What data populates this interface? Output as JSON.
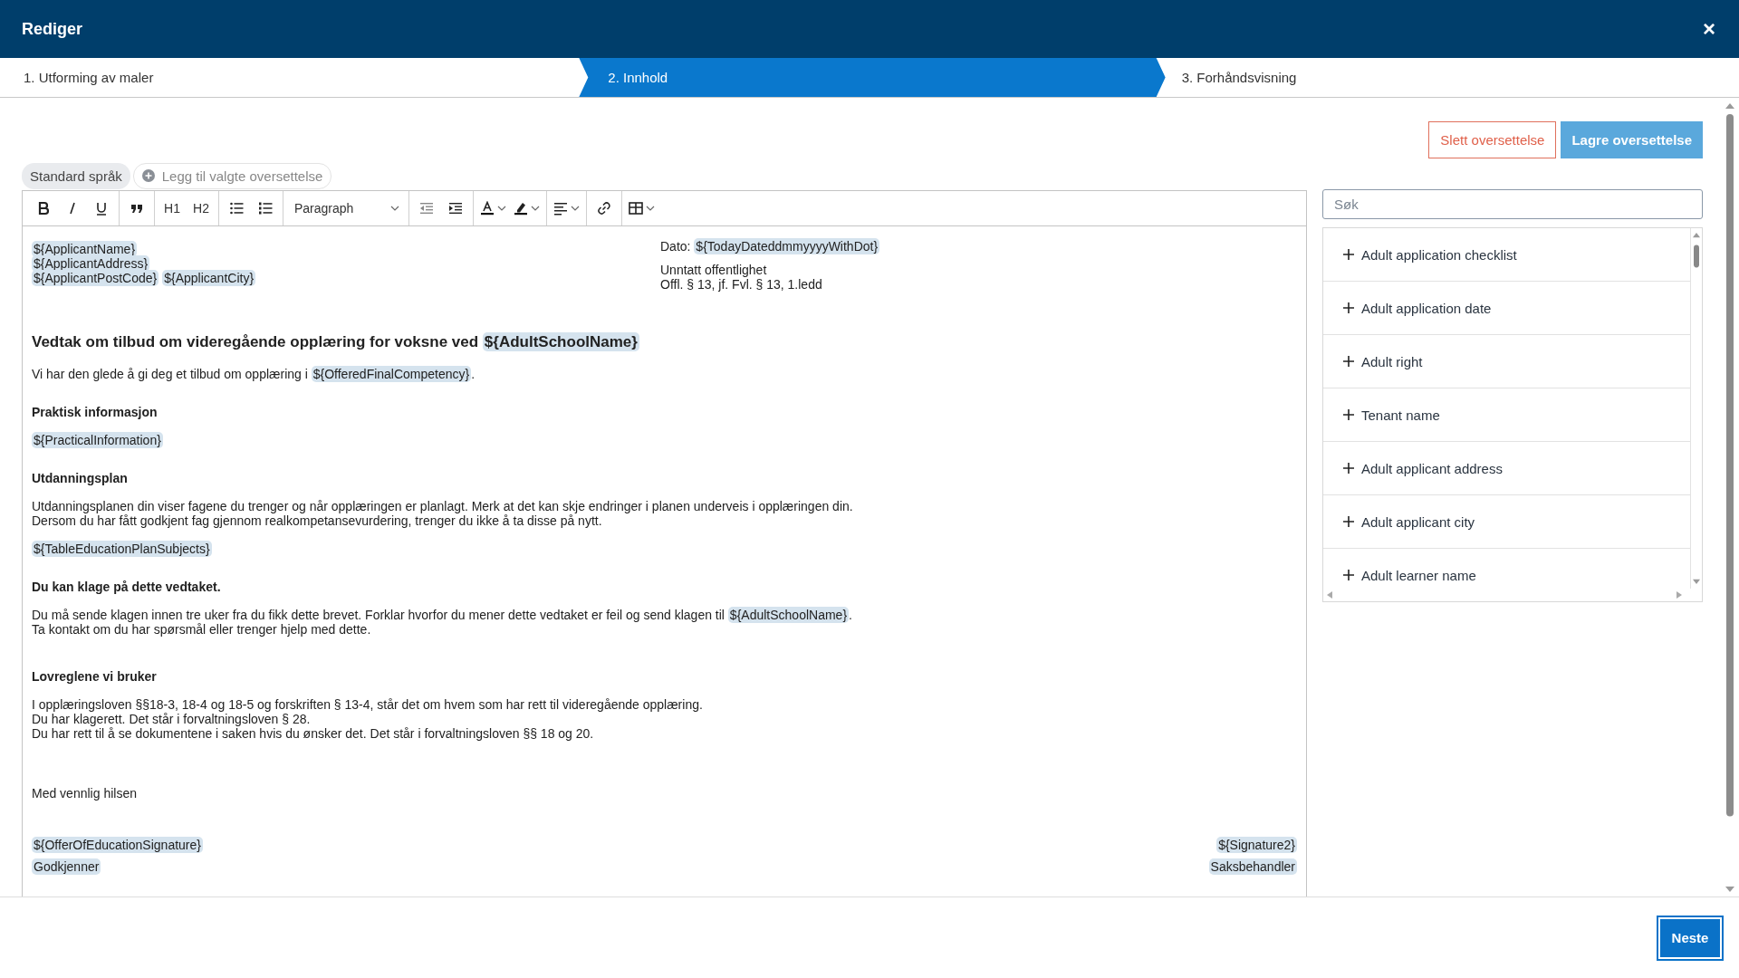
{
  "window": {
    "title": "Rediger",
    "close": "×"
  },
  "steps": [
    {
      "label": "1. Utforming av maler",
      "selected": false
    },
    {
      "label": "2. Innhold",
      "selected": true
    },
    {
      "label": "3. Forhåndsvisning",
      "selected": false
    }
  ],
  "actions": {
    "delete": "Slett oversettelse",
    "save": "Lagre oversettelse"
  },
  "languages": [
    {
      "label": "Standard språk",
      "kind": "chip"
    },
    {
      "label": "Legg til valgte oversettelse",
      "kind": "add"
    }
  ],
  "toolbar": [
    [
      {
        "kind": "bold"
      },
      {
        "kind": "italic"
      },
      {
        "kind": "underline"
      }
    ],
    [
      {
        "kind": "quote"
      }
    ],
    [
      {
        "kind": "heading",
        "label": "H1"
      },
      {
        "kind": "heading",
        "label": "H2"
      }
    ],
    [
      {
        "kind": "bullets"
      },
      {
        "kind": "numbers"
      }
    ],
    [
      {
        "kind": "format",
        "label": "Paragraph"
      }
    ],
    [
      {
        "kind": "outdent"
      },
      {
        "kind": "indent"
      }
    ],
    [
      {
        "kind": "font-color"
      },
      {
        "kind": "highlight"
      }
    ],
    [
      {
        "kind": "align"
      }
    ],
    [
      {
        "kind": "link"
      }
    ],
    [
      {
        "kind": "table"
      }
    ]
  ],
  "document": {
    "address": [
      [
        {
          "kind": "tag",
          "text": "${ApplicantName}"
        }
      ],
      [
        {
          "kind": "tag",
          "text": "${ApplicantAddress}"
        }
      ],
      [
        {
          "kind": "tag",
          "text": "${ApplicantPostCode}"
        },
        {
          "kind": "tag",
          "text": "${ApplicantCity}"
        }
      ]
    ],
    "meta": [
      [
        {
          "kind": "text",
          "text": "Dato: "
        },
        {
          "kind": "tag",
          "text": "${TodayDateddmmyyyyWithDot}"
        }
      ],
      [
        {
          "kind": "text",
          "text": "Unntatt offentlighet"
        }
      ],
      [
        {
          "kind": "text",
          "text": "Offl. § 13, jf. Fvl. § 13, 1.ledd"
        }
      ]
    ],
    "blocks": [
      {
        "kind": "heading",
        "lines": [
          [
            {
              "kind": "text",
              "text": "Vedtak om tilbud om videregående opplæring for voksne ved "
            },
            {
              "kind": "tag",
              "text": "${AdultSchoolName}"
            }
          ]
        ]
      },
      {
        "kind": "text",
        "lines": [
          [
            {
              "kind": "text",
              "text": "Vi har den glede å gi deg et tilbud om opplæring i "
            },
            {
              "kind": "tag",
              "text": "${OfferedFinalCompetency}"
            },
            {
              "kind": "text",
              "text": "."
            }
          ]
        ]
      },
      {
        "kind": "subheading",
        "lines": [
          [
            {
              "kind": "text",
              "text": "Praktisk informasjon"
            }
          ]
        ]
      },
      {
        "kind": "text",
        "lines": [
          [
            {
              "kind": "tag",
              "text": "${PracticalInformation}"
            }
          ]
        ]
      },
      {
        "kind": "subheading",
        "lines": [
          [
            {
              "kind": "text",
              "text": "Utdanningsplan"
            }
          ]
        ]
      },
      {
        "kind": "text",
        "lines": [
          [
            {
              "kind": "text",
              "text": "Utdanningsplanen din viser fagene du trenger og når opplæringen er planlagt. Merk at det kan skje endringer i planen underveis i opplæringen din."
            }
          ],
          [
            {
              "kind": "text",
              "text": "Dersom du har fått godkjent fag gjennom realkompetansevurdering, trenger du ikke å ta disse på nytt."
            }
          ]
        ]
      },
      {
        "kind": "text",
        "lines": [
          [
            {
              "kind": "tag",
              "text": "${TableEducationPlanSubjects}"
            }
          ]
        ]
      },
      {
        "kind": "subheading",
        "lines": [
          [
            {
              "kind": "text",
              "text": "Du kan klage på dette vedtaket."
            }
          ]
        ]
      },
      {
        "kind": "text",
        "lines": [
          [
            {
              "kind": "text",
              "text": "Du må sende klagen innen tre uker fra du fikk dette brevet. Forklar hvorfor du mener dette vedtaket er feil og send klagen til "
            },
            {
              "kind": "tag",
              "text": "${AdultSchoolName}"
            },
            {
              "kind": "text",
              "text": "."
            }
          ],
          [
            {
              "kind": "text",
              "text": "Ta kontakt om du har spørsmål eller trenger hjelp med dette."
            }
          ]
        ]
      },
      {
        "kind": "section",
        "lines": [
          [
            {
              "kind": "text",
              "text": "Lovreglene vi bruker"
            }
          ]
        ]
      },
      {
        "kind": "text",
        "lines": [
          [
            {
              "kind": "text",
              "text": "I opplæringsloven §§18-3, 18-4 og 18-5 og forskriften § 13-4, står det om hvem som har rett til videregående opplæring."
            }
          ],
          [
            {
              "kind": "text",
              "text": "Du har klagerett. Det står i forvaltningsloven § 28."
            }
          ],
          [
            {
              "kind": "text",
              "text": "Du har rett til å se dokumentene i saken hvis du ønsker det. Det står i forvaltningsloven §§ 18 og 20."
            }
          ]
        ]
      },
      {
        "kind": "closing",
        "lines": [
          [
            {
              "kind": "text",
              "text": "Med vennlig hilsen"
            }
          ]
        ]
      }
    ],
    "signatures": [
      {
        "left": "${OfferOfEducationSignature}",
        "right": "${Signature2}"
      },
      {
        "left": "Godkjenner",
        "right": "Saksbehandler"
      }
    ]
  },
  "fields": {
    "search": {
      "placeholder": "Søk"
    },
    "items": [
      "Adult application checklist",
      "Adult application date",
      "Adult right",
      "Tenant name",
      "Adult applicant address",
      "Adult applicant city",
      "Adult learner name"
    ]
  },
  "footer": {
    "next": "Neste"
  }
}
